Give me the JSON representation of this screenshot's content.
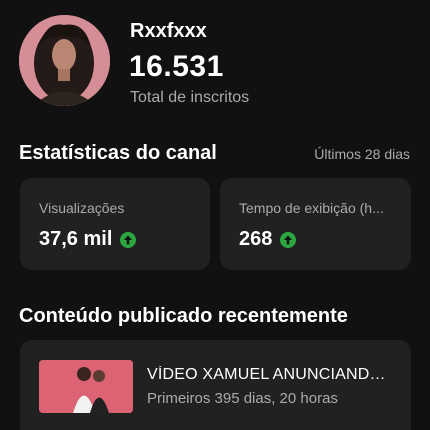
{
  "channel": {
    "name": "Rxxfxxx",
    "subscriber_count": "16.531",
    "subscriber_label": "Total de inscritos"
  },
  "stats": {
    "title": "Estatísticas do canal",
    "period": "Últimos 28 dias",
    "views": {
      "label": "Visualizações",
      "value": "37,6 mil",
      "trend_icon": "arrow-up-icon"
    },
    "watch_time": {
      "label": "Tempo de exibição (h...",
      "value": "268",
      "trend_icon": "arrow-up-icon"
    }
  },
  "recent": {
    "title": "Conteúdo publicado recentemente",
    "video": {
      "title": "VÍDEO XAMUEL ANUNCIANDO ...",
      "meta": "Primeiros 395 dias, 20 horas",
      "thumbnail_icon": "video-thumbnail"
    }
  },
  "colors": {
    "background": "#111111",
    "card": "#212121",
    "secondary_text": "#aaaaaa",
    "trend_green": "#2ba640"
  }
}
